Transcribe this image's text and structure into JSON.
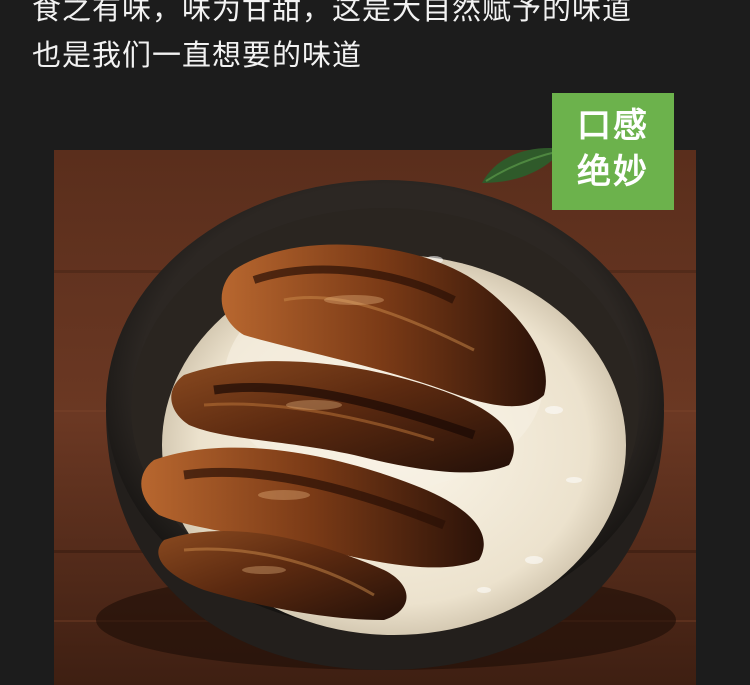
{
  "copy": {
    "line1": "食之有味，味为甘甜，这是大自然赋予的味道",
    "line2": "也是我们一直想要的味道"
  },
  "badge": {
    "line1": "口感",
    "line2": "绝妙",
    "color": "#6cb24c"
  },
  "photo": {
    "subject": "eel rice bowl"
  }
}
